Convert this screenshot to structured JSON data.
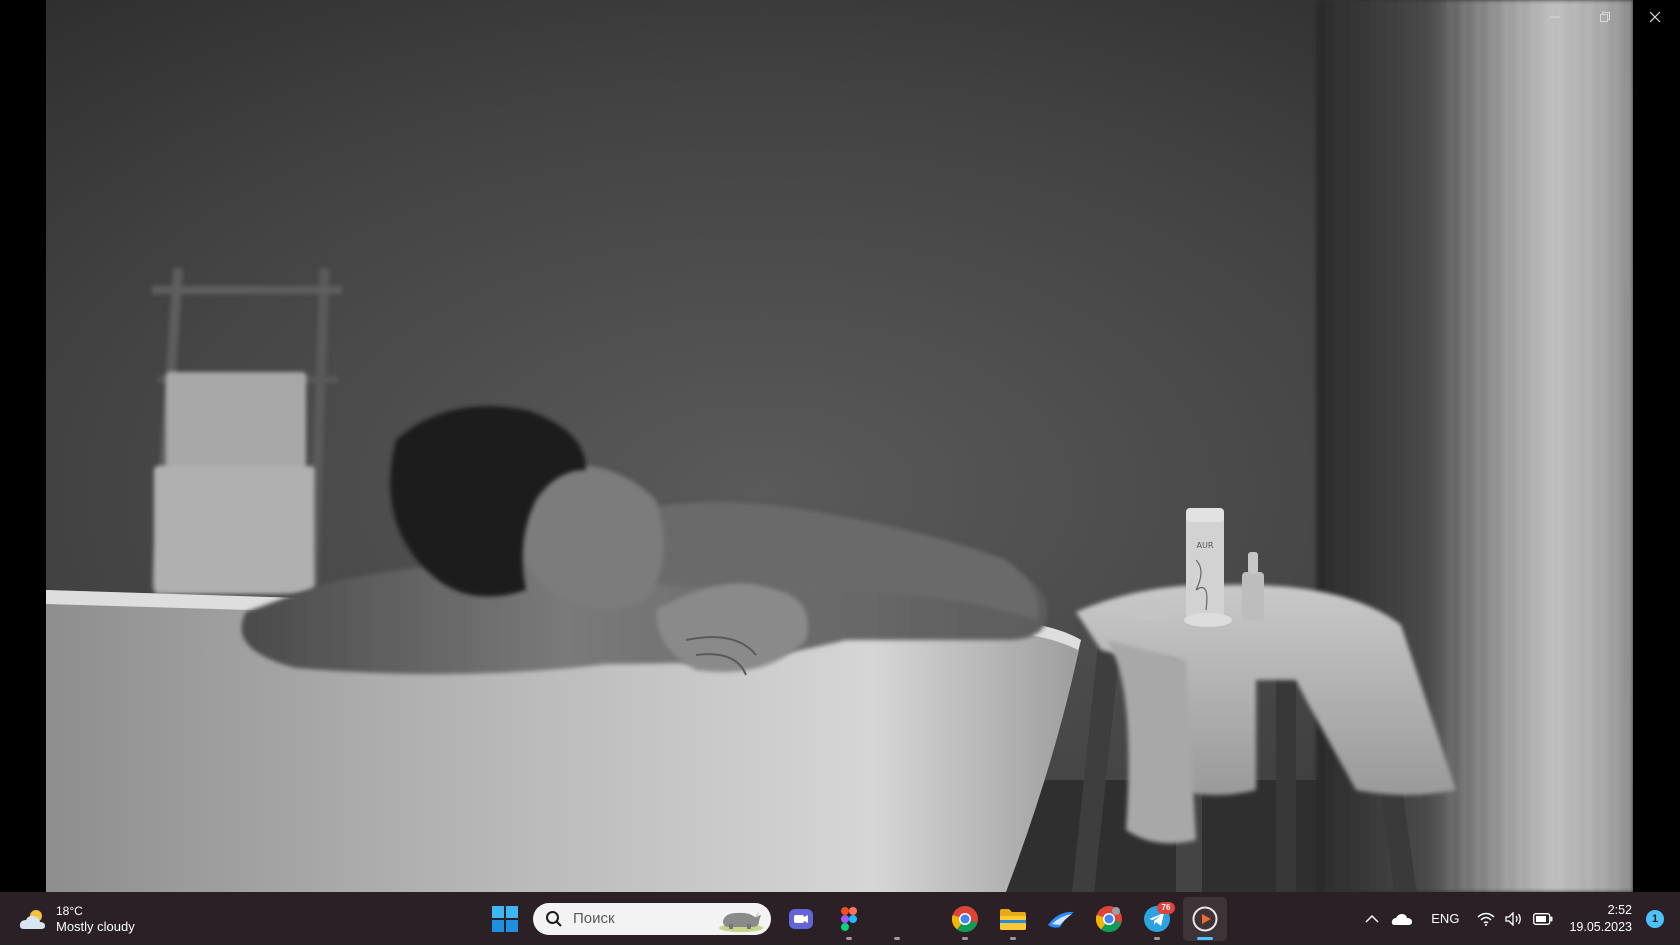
{
  "viewer": {
    "window_controls": [
      {
        "name": "minimize-button",
        "icon": "minimize-icon"
      },
      {
        "name": "restore-button",
        "icon": "restore-icon"
      },
      {
        "name": "close-button",
        "icon": "close-icon"
      }
    ],
    "photo": {
      "icon": "black-and-white-bathroom-photo",
      "bottle_label": "AUR"
    }
  },
  "taskbar": {
    "weather": {
      "icon": "partly-cloudy-icon",
      "temperature": "18°C",
      "description": "Mostly cloudy"
    },
    "search": {
      "placeholder": "Поиск",
      "icon": "search-icon",
      "highlight_icon": "rhino-icon"
    },
    "pinned": [
      {
        "name": "start-button",
        "icon": "windows-logo-icon",
        "running": false
      },
      {
        "name": "teams-app",
        "icon": "video-camera-icon",
        "running": false
      },
      {
        "name": "figma-app",
        "icon": "figma-icon",
        "running": true
      },
      {
        "name": "empty-app",
        "icon": "",
        "running": true
      },
      {
        "name": "chrome-app",
        "icon": "chrome-icon",
        "running": true
      },
      {
        "name": "file-explorer-app",
        "icon": "folder-icon",
        "running": true
      },
      {
        "name": "swift-app",
        "icon": "swift-icon",
        "running": false
      },
      {
        "name": "chrome-dev-app",
        "icon": "chrome-icon",
        "running": false
      },
      {
        "name": "telegram-app",
        "icon": "telegram-icon",
        "running": true,
        "badge": "76"
      },
      {
        "name": "media-player-app",
        "icon": "play-icon",
        "running": true,
        "active": true
      }
    ],
    "tray": {
      "chevron_icon": "chevron-up-icon",
      "cloud_icon": "onedrive-icon",
      "language": "ENG",
      "wifi_icon": "wifi-icon",
      "volume_icon": "volume-icon",
      "battery_icon": "battery-icon",
      "time": "2:52",
      "date": "19.05.2023",
      "notification_count": "1"
    }
  },
  "colors": {
    "taskbar_bg": "#2b2025",
    "accent": "#4cc2ff",
    "badge": "#e0413c"
  }
}
